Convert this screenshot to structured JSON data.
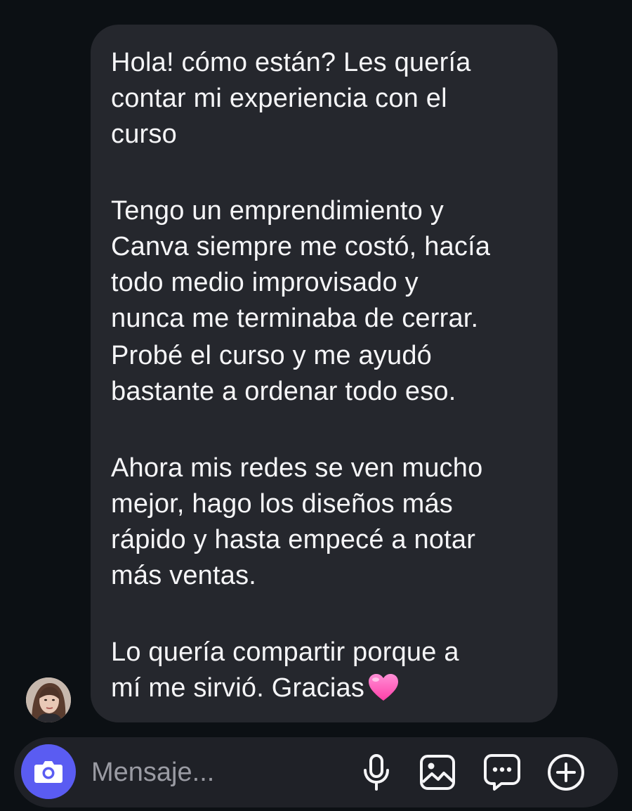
{
  "message": {
    "paragraphs": [
      "Hola! cómo están? Les quería\ncontar mi experiencia con el\ncurso",
      "Tengo un emprendimiento y\nCanva siempre me costó, hacía\ntodo medio improvisado y\nnunca me terminaba de cerrar.",
      "Probé el curso y me ayudó\nbastante a ordenar todo eso.",
      "Ahora mis redes se ven mucho\nmejor, hago los diseños más\nrápido y hasta empecé a notar\nmás ventas.",
      "Lo quería compartir porque a\nmí me sirvió. Gracias"
    ],
    "emoji": "pink-heart"
  },
  "composer": {
    "placeholder": "Mensaje...",
    "icons": [
      "camera-icon",
      "microphone-icon",
      "gallery-icon",
      "sticker-icon",
      "add-icon"
    ]
  },
  "colors": {
    "background": "#0c1014",
    "bubble": "#25272d",
    "text": "#f5f5f7",
    "composer": "#1f2127",
    "camera_button": "#5a5cf2",
    "placeholder": "#9a9ba3",
    "heart": "#ff5fc1"
  }
}
